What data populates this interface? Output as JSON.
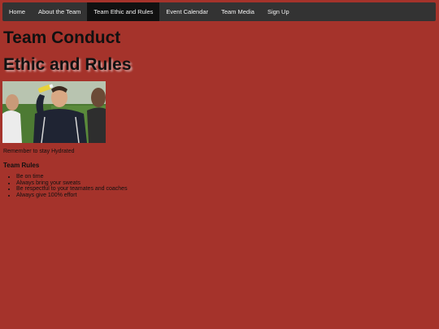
{
  "nav": {
    "items": [
      {
        "label": "Home"
      },
      {
        "label": "About the Team"
      },
      {
        "label": "Team Ethic and Rules"
      },
      {
        "label": "Event Calendar"
      },
      {
        "label": "Team Media"
      },
      {
        "label": "Sign Up"
      }
    ],
    "active_index": 2
  },
  "content": {
    "title": "Team Conduct",
    "subtitle": "Ethic and Rules",
    "image_alt": "Player drinking water",
    "caption": "Remember to stay Hydrated",
    "rules_heading": "Team Rules",
    "rules": [
      "Be on time",
      "Always bring your sweats",
      "Be respectful to your teamates and coaches",
      "Always give 100% effort"
    ]
  },
  "colors": {
    "background": "#a5332b",
    "navbar": "#333333",
    "nav_active": "#111111",
    "nav_text": "#f2f2f2"
  }
}
